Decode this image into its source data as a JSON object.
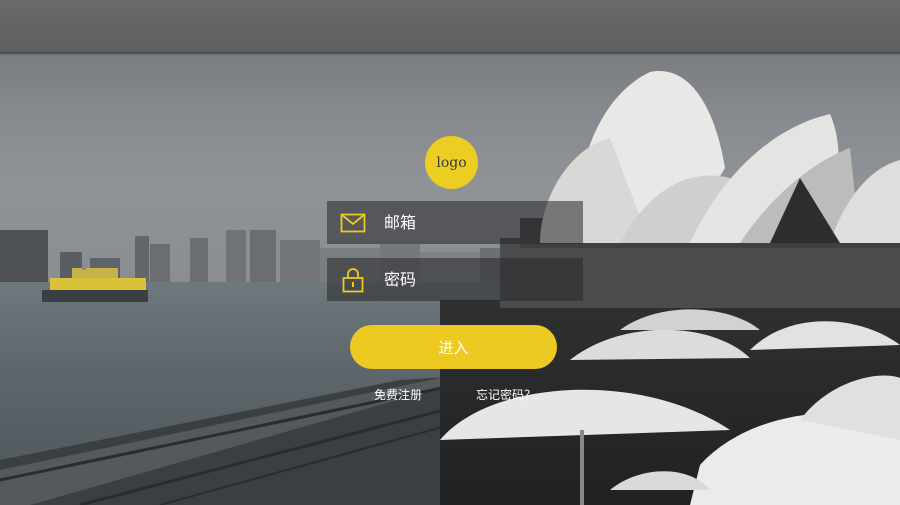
{
  "logo": {
    "text": "logo"
  },
  "email": {
    "placeholder": "邮箱",
    "value": ""
  },
  "password": {
    "placeholder": "密码",
    "value": ""
  },
  "submit": {
    "label": "进入"
  },
  "links": {
    "register": "免费注册",
    "forgot": "忘记密码？"
  },
  "colors": {
    "accent": "#ECCA22",
    "field_bg": "rgba(40,40,42,0.55)",
    "text": "#FFFFFF"
  },
  "icons": {
    "email": "envelope-icon",
    "password": "padlock-icon"
  }
}
